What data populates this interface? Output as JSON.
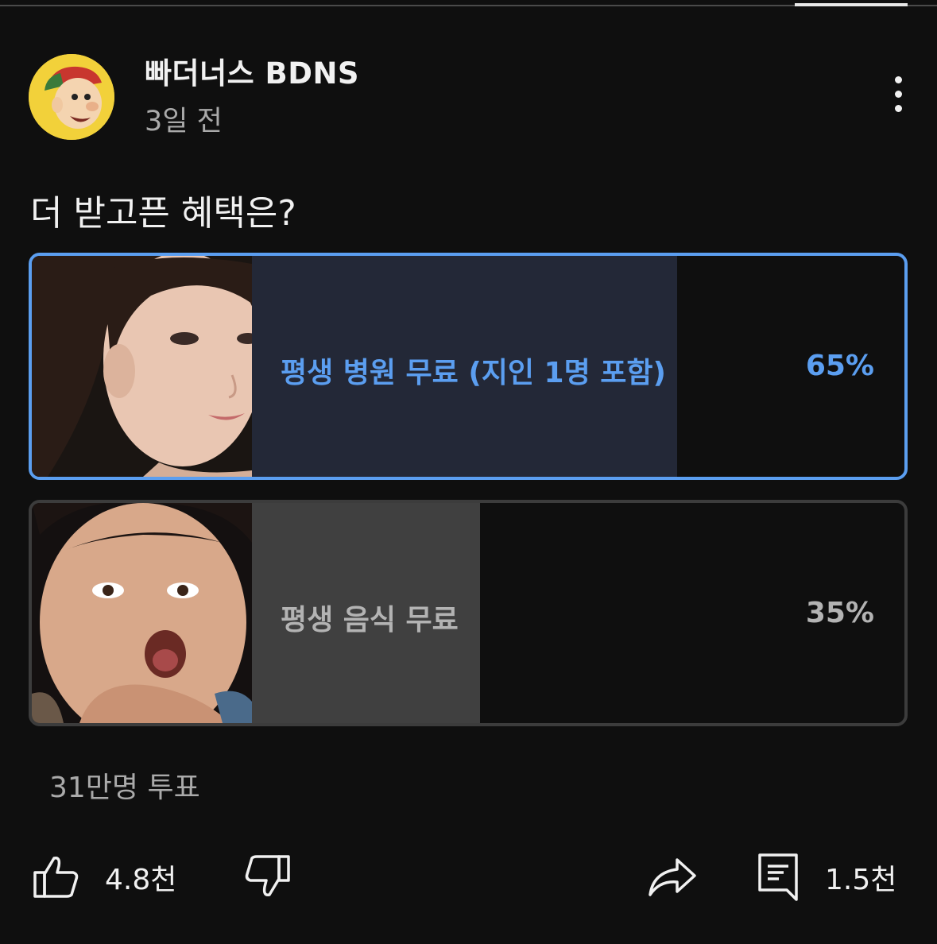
{
  "post": {
    "channel_name": "빠더너스 BDNS",
    "time": "3일 전",
    "question": "더 받고픈 혜택은?"
  },
  "poll": {
    "options": [
      {
        "label": "평생 병원 무료 (지인 1명 포함)",
        "percent": "65%",
        "selected": true
      },
      {
        "label": "평생 음식 무료",
        "percent": "35%",
        "selected": false
      }
    ],
    "votes": "31만명 투표"
  },
  "actions": {
    "like_icon": "thumbs-up-icon",
    "like_count": "4.8천",
    "dislike_icon": "thumbs-down-icon",
    "share_icon": "share-icon",
    "comment_icon": "comment-icon",
    "comment_count": "1.5천"
  },
  "colors": {
    "accent": "#5b9ef0",
    "background": "#0f0f0f",
    "selected_fill": "#232837",
    "unselected_fill": "#404040"
  }
}
